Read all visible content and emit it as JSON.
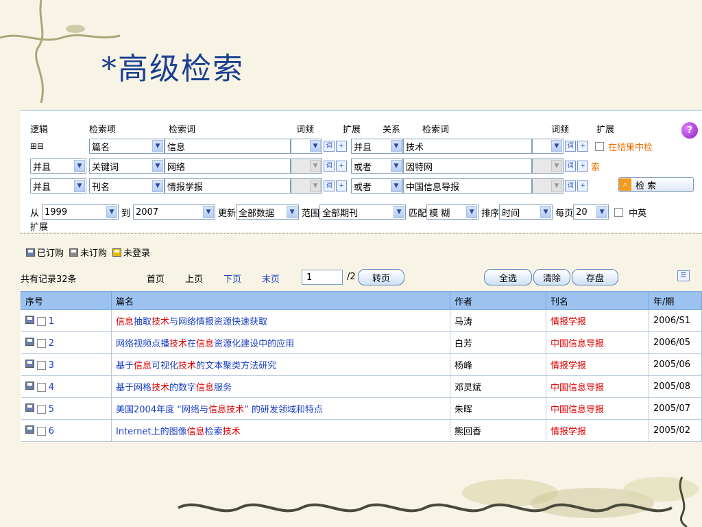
{
  "slide": {
    "title": "*高级检索"
  },
  "panel": {
    "headers": {
      "logic": "逻辑",
      "field": "检索项",
      "term": "检索词",
      "freq": "词频",
      "expand": "扩展",
      "relation": "关系",
      "term2": "检索词",
      "freq2": "词频",
      "expand2": "扩展"
    },
    "plus_minus": "⊞⊟",
    "rows": [
      {
        "logic": "",
        "field": "篇名",
        "term": "信息",
        "relation": "并且",
        "term2": "技术"
      },
      {
        "logic": "并且",
        "field": "关键词",
        "term": "网络",
        "relation": "或者",
        "term2": "因特网"
      },
      {
        "logic": "并且",
        "field": "刊名",
        "term": "情报学报",
        "relation": "或者",
        "term2": "中国信息导报"
      }
    ],
    "in_results_label_a": "在结果中检",
    "in_results_label_b": "索",
    "search_button": "检 索",
    "help_icon": "?",
    "from_label": "从",
    "from_year": "1999",
    "to_label": "到",
    "to_year": "2007",
    "update_label": "更新",
    "update_value": "全部数据",
    "scope_label": "范围",
    "scope_value": "全部期刊",
    "match_label": "匹配",
    "match_value": "模 糊",
    "sort_label": "排序",
    "sort_value": "时间",
    "per_page_label": "每页",
    "per_page_value": "20",
    "zh_en_label": "中英",
    "expand_label": "扩展"
  },
  "legend": {
    "subscribed": "已订购",
    "unsubscribed": "未订购",
    "not_logged_in": "未登录"
  },
  "pager": {
    "total": "共有记录32条",
    "first": "首页",
    "prev": "上页",
    "next": "下页",
    "last": "末页",
    "page_value": "1",
    "page_total": "/2",
    "goto": "转页",
    "select_all": "全选",
    "clear": "清除",
    "save": "存盘"
  },
  "table": {
    "columns": [
      "序号",
      "篇名",
      "作者",
      "刊名",
      "年/期"
    ],
    "rows": [
      {
        "num": "1",
        "title": [
          [
            "信息",
            true
          ],
          [
            "抽取",
            false
          ],
          [
            "技术",
            true
          ],
          [
            "与网络情报资源快速获取",
            false
          ]
        ],
        "author": "马涛",
        "journal": "情报学报",
        "issue": "2006/S1"
      },
      {
        "num": "2",
        "title": [
          [
            "网络视频点播",
            false
          ],
          [
            "技术",
            true
          ],
          [
            "在",
            false
          ],
          [
            "信息",
            true
          ],
          [
            "资源化建设中的应用",
            false
          ]
        ],
        "author": "白芳",
        "journal": "中国信息导报",
        "issue": "2006/05"
      },
      {
        "num": "3",
        "title": [
          [
            "基于",
            false
          ],
          [
            "信息",
            true
          ],
          [
            "可视化",
            false
          ],
          [
            "技术",
            true
          ],
          [
            "的文本聚类方法研究",
            false
          ]
        ],
        "author": "杨峰",
        "journal": "情报学报",
        "issue": "2005/06"
      },
      {
        "num": "4",
        "title": [
          [
            "基于网格",
            false
          ],
          [
            "技术",
            true
          ],
          [
            "的数字",
            false
          ],
          [
            "信息",
            true
          ],
          [
            "服务",
            false
          ]
        ],
        "author": "邓灵斌",
        "journal": "中国信息导报",
        "issue": "2005/08"
      },
      {
        "num": "5",
        "title": [
          [
            "美国2004年度 “网络与",
            false
          ],
          [
            "信息",
            true
          ],
          [
            "技术",
            true
          ],
          [
            "” 的研发领域和特点",
            false
          ]
        ],
        "author": "朱晖",
        "journal": "中国信息导报",
        "issue": "2005/07"
      },
      {
        "num": "6",
        "title": [
          [
            "Internet上的图像",
            false
          ],
          [
            "信息",
            true
          ],
          [
            "检索",
            false
          ],
          [
            "技术",
            true
          ]
        ],
        "author": "熊回香",
        "journal": "情报学报",
        "issue": "2005/02"
      }
    ]
  },
  "colors": {
    "title": "#1b3f8f",
    "highlight": "#e00000",
    "link": "#1a3fc2",
    "header_bg": "#9cc3f0",
    "orange": "#f07000"
  }
}
